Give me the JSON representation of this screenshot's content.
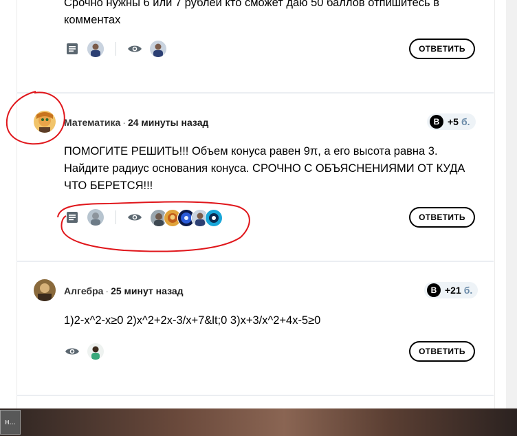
{
  "questions": [
    {
      "text": "Срочно нужны 6 или 7 рублей кто сможет даю 50 баллов отпишитесь в комментах",
      "answer_label": "ОТВЕТИТЬ"
    },
    {
      "subject": "Математика",
      "time": "24 минуты назад",
      "points": "+5",
      "points_unit": "б.",
      "text": "ПОМОГИТЕ РЕШИТЬ!!! Объем конуса равен 9π, а его высота равна 3. Найдите радиус основания конуса. СРОЧНО С ОБЪЯСНЕНИЯМИ ОТ КУДА ЧТО БЕРЕТСЯ!!!",
      "answer_label": "ОТВЕТИТЬ"
    },
    {
      "subject": "Алгебра",
      "time": "25 минут назад",
      "points": "+21",
      "points_unit": "б.",
      "text": "1)2-x^2-x≥0 2)x^2+2x-3/x+7&lt;0 3)x+3/x^2+4x-5≥0",
      "answer_label": "ОТВЕТИТЬ"
    }
  ],
  "taskbar": {
    "tab_label": "н..."
  },
  "icons": [
    "document-icon",
    "eye-icon",
    "points-b-icon"
  ],
  "colors": {
    "annotation": "#e0161b",
    "points_bg": "#eef3f7",
    "points_unit": "#6a8aa8"
  }
}
